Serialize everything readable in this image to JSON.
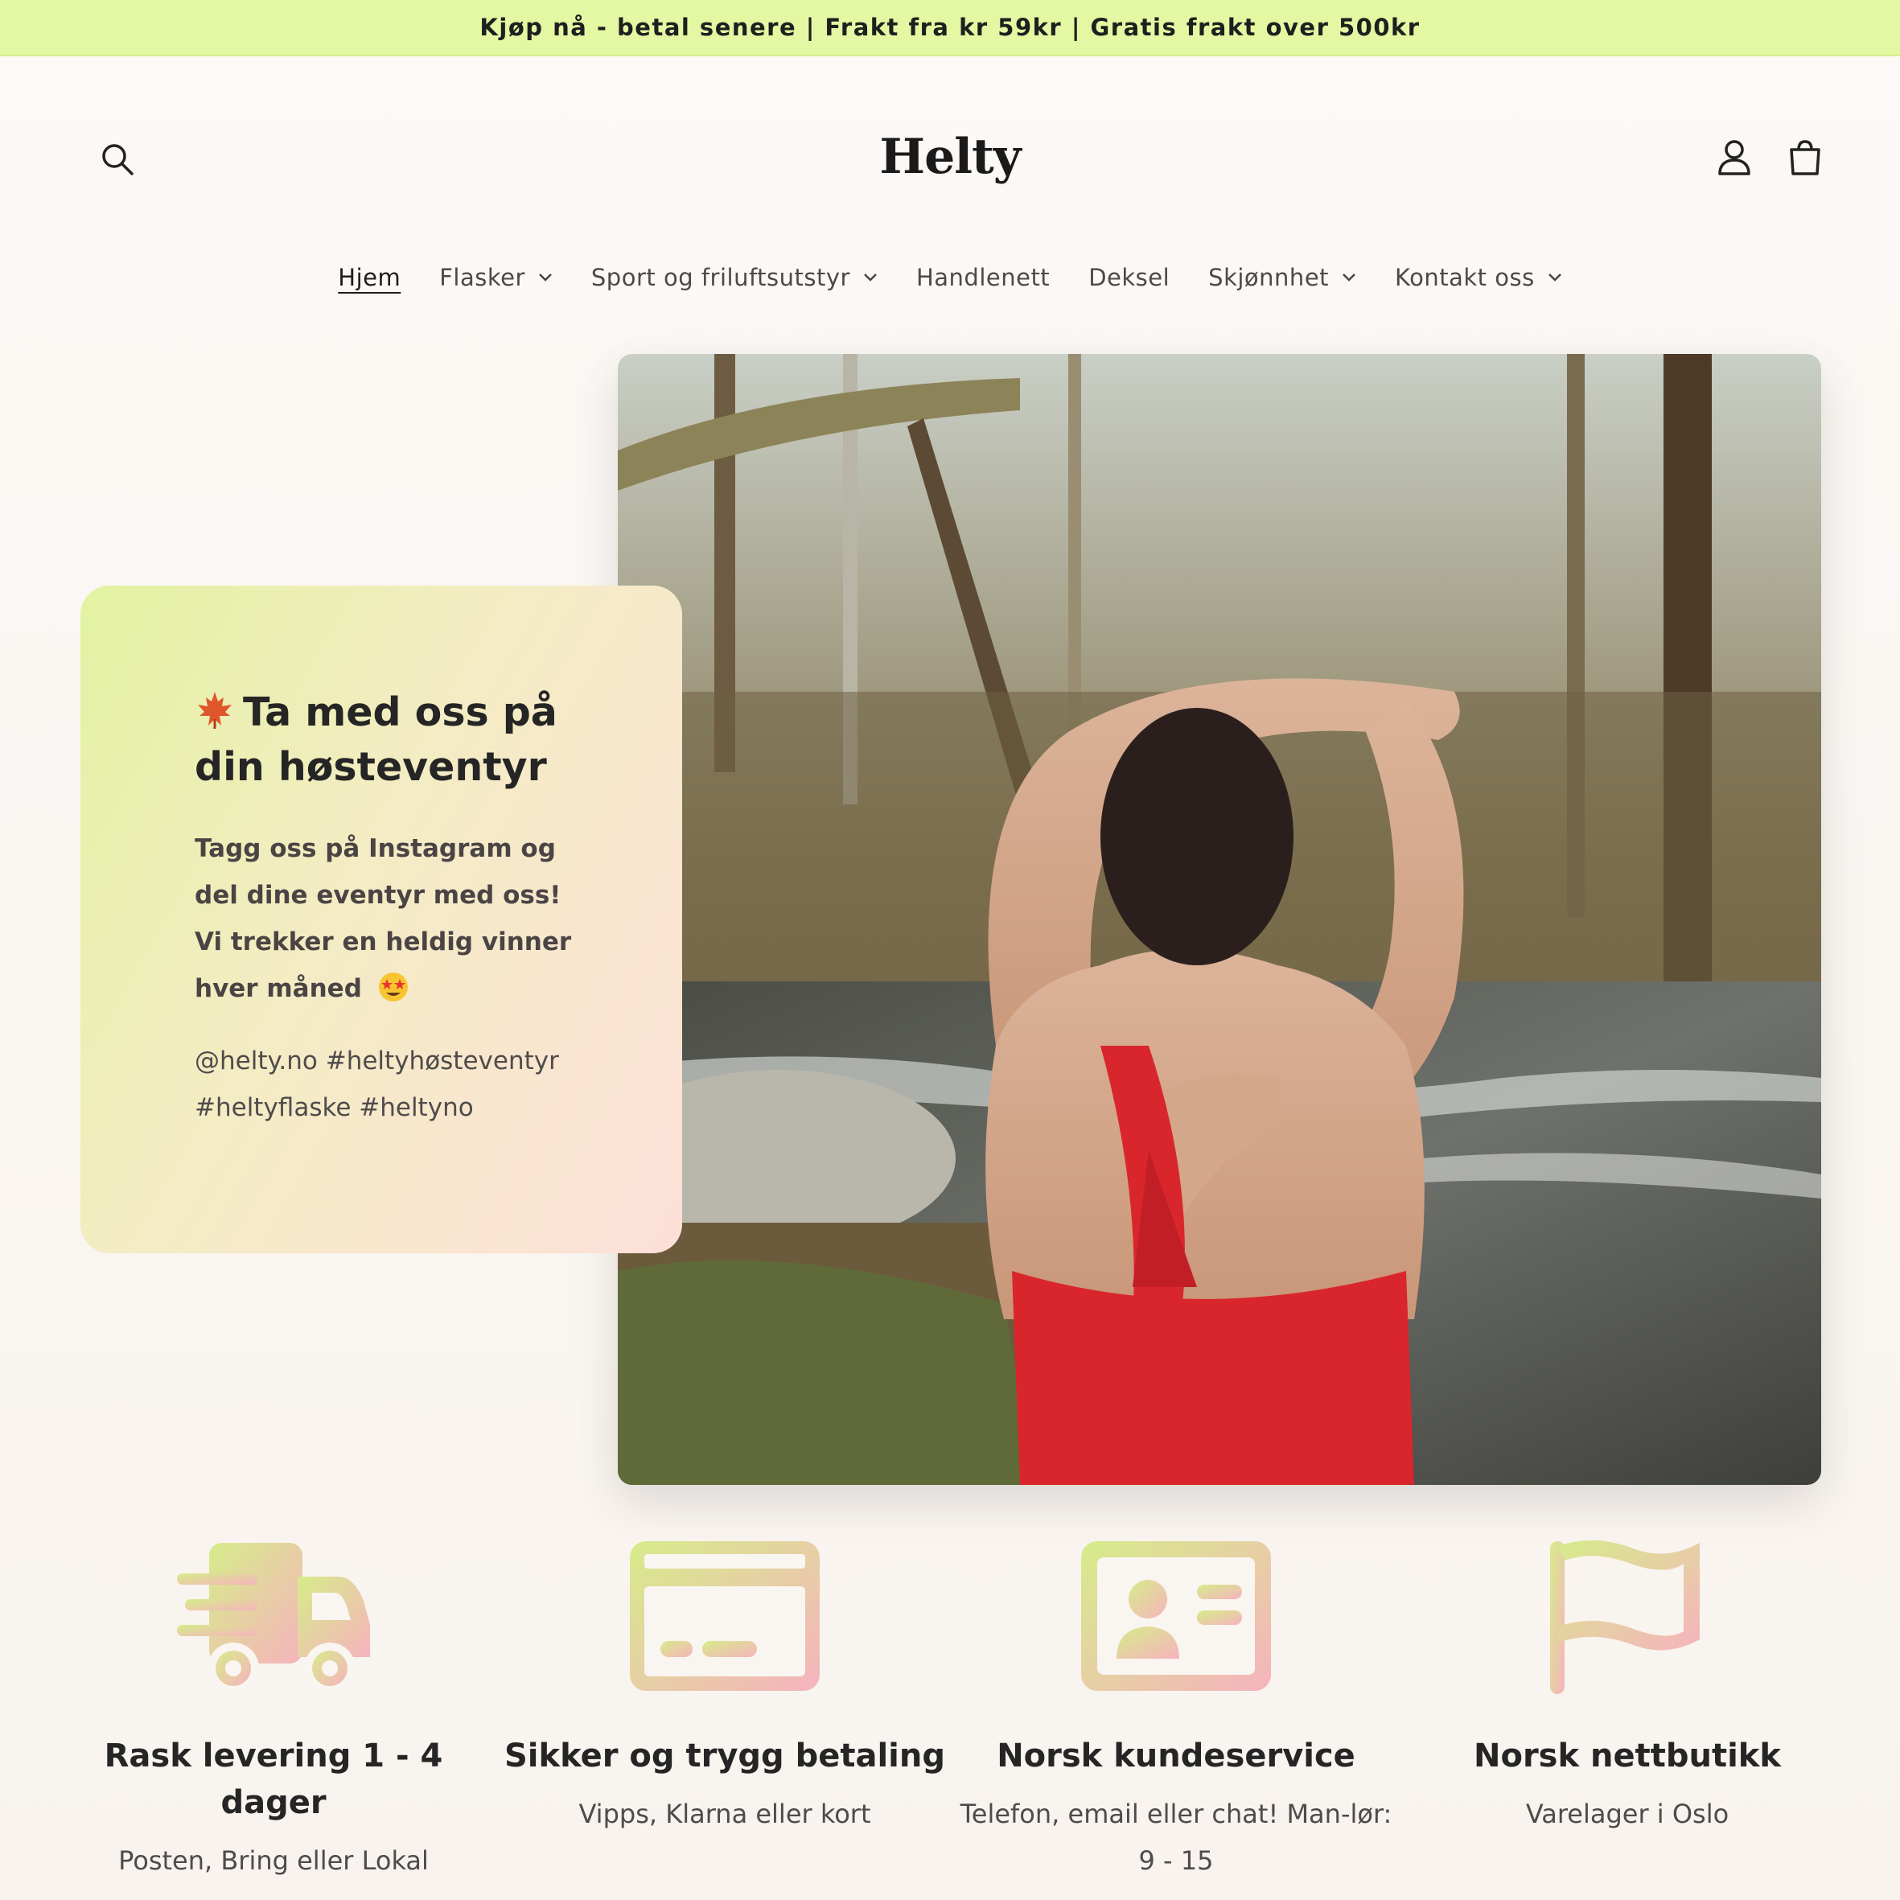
{
  "announcement": "Kjøp nå - betal senere | Frakt fra kr 59kr | Gratis frakt over 500kr",
  "brand": "Helty",
  "header": {
    "search_icon": "search-icon",
    "account_icon": "account-icon",
    "cart_icon": "cart-icon"
  },
  "nav": [
    {
      "label": "Hjem",
      "active": true,
      "dropdown": false
    },
    {
      "label": "Flasker",
      "active": false,
      "dropdown": true
    },
    {
      "label": "Sport og friluftsutstyr",
      "active": false,
      "dropdown": true
    },
    {
      "label": "Handlenett",
      "active": false,
      "dropdown": false
    },
    {
      "label": "Deksel",
      "active": false,
      "dropdown": false
    },
    {
      "label": "Skjønnhet",
      "active": false,
      "dropdown": true
    },
    {
      "label": "Kontakt oss",
      "active": false,
      "dropdown": true
    }
  ],
  "hero": {
    "title": "Ta med oss på din høsteventyr",
    "body": "Tagg oss på Instagram og del dine eventyr med oss! Vi trekker en heldig vinner hver måned",
    "tags": "@helty.no #heltyhøsteventyr #heltyflaske #heltyno",
    "title_icon": "maple-leaf-icon",
    "body_icon": "star-struck-emoji-icon"
  },
  "features": [
    {
      "icon": "delivery-truck-icon",
      "title": "Rask levering 1 - 4 dager",
      "sub": "Posten, Bring eller Lokal"
    },
    {
      "icon": "credit-card-icon",
      "title": "Sikker og trygg betaling",
      "sub": "Vipps, Klarna eller kort"
    },
    {
      "icon": "contact-card-icon",
      "title": "Norsk kundeservice",
      "sub": "Telefon, email eller chat! Man-lør: 9 - 15"
    },
    {
      "icon": "flag-icon",
      "title": "Norsk nettbutikk",
      "sub": "Varelager i Oslo"
    }
  ],
  "colors": {
    "announcement_bg": "#e4f7a2",
    "gradient_start": "#d8ec8c",
    "gradient_end": "#f5b8c0"
  }
}
